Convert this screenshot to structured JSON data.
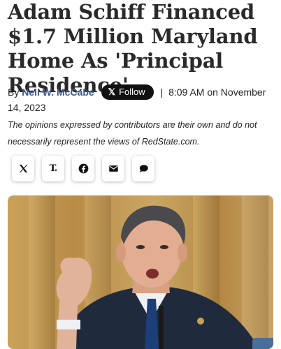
{
  "article": {
    "headline": "Adam Schiff Financed $1.7 Million Maryland Home As 'Principal Residence'",
    "byline": {
      "by": "By",
      "author": "Neil W. McCabe",
      "follow_label": "Follow",
      "separator": "|",
      "timestamp": "8:09 AM on November 14, 2023"
    },
    "disclaimer": "The opinions expressed by contributors are their own and do not necessarily represent the views of RedState.com."
  },
  "share": [
    {
      "icon": "x-logo-icon"
    },
    {
      "icon": "truth-social-icon"
    },
    {
      "icon": "facebook-icon"
    },
    {
      "icon": "email-icon"
    },
    {
      "icon": "comment-icon"
    }
  ],
  "colors": {
    "author_link": "#3b5b8c",
    "follow_bg": "#111111",
    "headline": "#2a2a2a"
  }
}
